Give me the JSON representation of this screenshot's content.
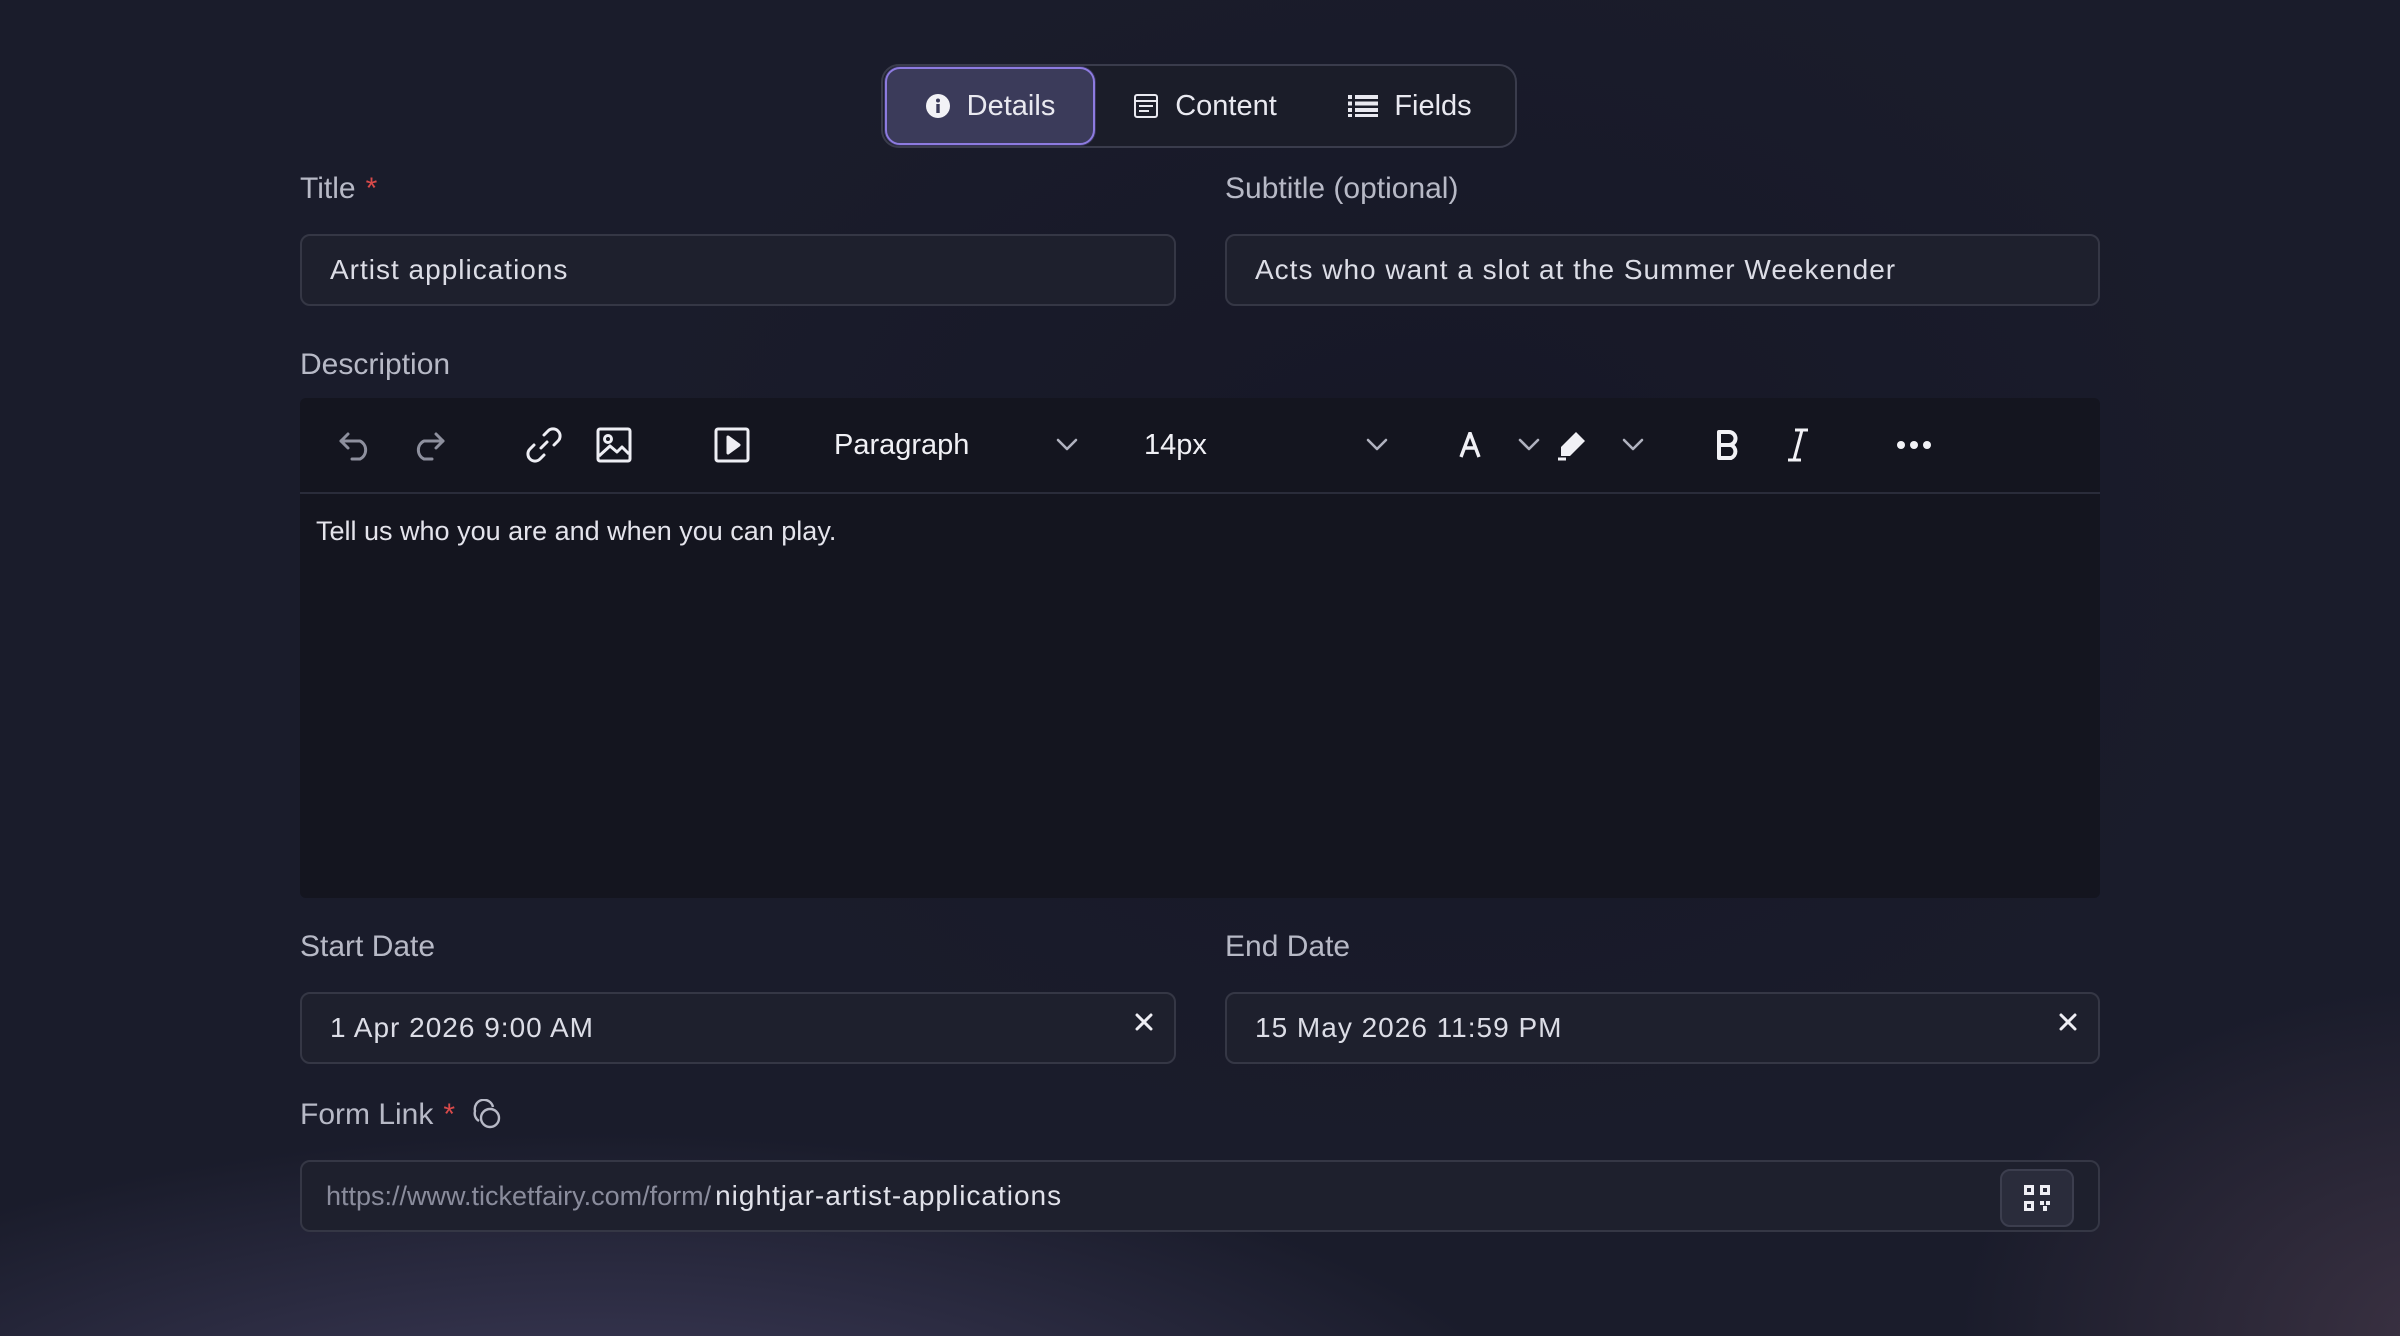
{
  "tabs": {
    "details": "Details",
    "content": "Content",
    "fields": "Fields"
  },
  "form": {
    "title_label": "Title",
    "required_mark": "*",
    "title_value": "Artist applications",
    "subtitle_label": "Subtitle (optional)",
    "subtitle_value": "Acts who want a slot at the Summer Weekender",
    "description_label": "Description",
    "start_label": "Start Date",
    "start_value": "1 Apr 2026 9:00 AM",
    "end_label": "End Date",
    "end_value": "15 May 2026 11:59 PM",
    "link_label": "Form Link",
    "link_prefix": "https://www.ticketfairy.com/form/",
    "link_slug": "nightjar-artist-applications"
  },
  "editor": {
    "block_format": "Paragraph",
    "font_size": "14px",
    "body_text": "Tell us who you are and when you can play."
  },
  "colors": {
    "accent": "#8d7be0",
    "required": "#d94a4a",
    "background": "#1a1c2a"
  }
}
